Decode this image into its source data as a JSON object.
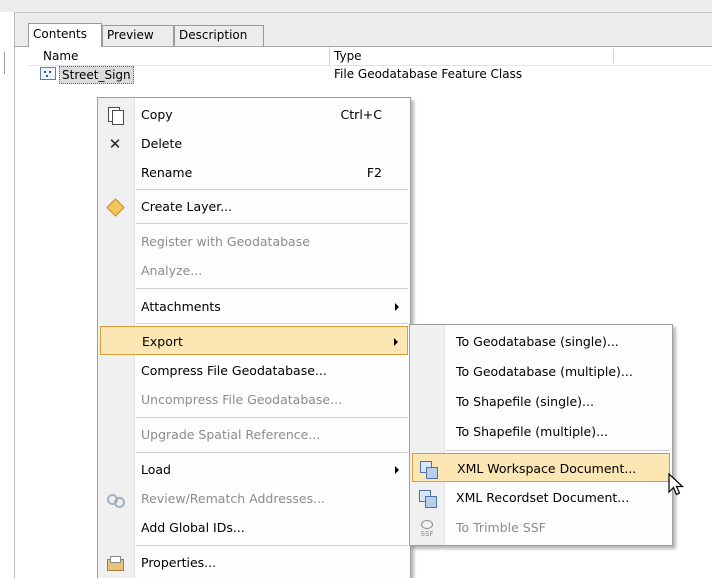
{
  "tabs": [
    {
      "label": "Contents",
      "active": true
    },
    {
      "label": "Preview",
      "active": false
    },
    {
      "label": "Description",
      "active": false
    }
  ],
  "columns": {
    "name": "Name",
    "type": "Type"
  },
  "rows": [
    {
      "name": "Street_Sign",
      "type": "File Geodatabase Feature Class",
      "icon": "point-feature-class-icon"
    }
  ],
  "context_menu": {
    "items": [
      {
        "label": "Copy",
        "shortcut": "Ctrl+C",
        "icon": "copy-icon",
        "enabled": true
      },
      {
        "label": "Delete",
        "shortcut": "",
        "icon": "delete-icon",
        "enabled": true
      },
      {
        "label": "Rename",
        "shortcut": "F2",
        "icon": "",
        "enabled": true
      },
      {
        "label": "Create Layer...",
        "icon": "layer-icon",
        "enabled": true
      },
      {
        "label": "Register with Geodatabase",
        "enabled": false
      },
      {
        "label": "Analyze...",
        "enabled": false
      },
      {
        "label": "Attachments",
        "submenu": true,
        "enabled": true
      },
      {
        "label": "Export",
        "submenu": true,
        "enabled": true,
        "highlighted": true
      },
      {
        "label": "Compress File Geodatabase...",
        "enabled": true
      },
      {
        "label": "Uncompress File Geodatabase...",
        "enabled": false
      },
      {
        "label": "Upgrade Spatial Reference...",
        "enabled": false
      },
      {
        "label": "Load",
        "submenu": true,
        "enabled": true
      },
      {
        "label": "Review/Rematch Addresses...",
        "icon": "review-icon",
        "enabled": false
      },
      {
        "label": "Add Global IDs...",
        "enabled": true
      },
      {
        "label": "Properties...",
        "icon": "properties-icon",
        "enabled": true
      }
    ]
  },
  "export_submenu": {
    "items": [
      {
        "label": "To Geodatabase (single)...",
        "enabled": true
      },
      {
        "label": "To Geodatabase (multiple)...",
        "enabled": true
      },
      {
        "label": "To Shapefile (single)...",
        "enabled": true
      },
      {
        "label": "To Shapefile (multiple)...",
        "enabled": true
      },
      {
        "label": "XML Workspace Document...",
        "icon": "xml-workspace-icon",
        "enabled": true,
        "highlighted": true
      },
      {
        "label": "XML Recordset Document...",
        "icon": "xml-recordset-icon",
        "enabled": true
      },
      {
        "label": "To Trimble SSF",
        "icon": "trimble-ssf-icon",
        "icon_text": "SSF",
        "enabled": false
      }
    ]
  },
  "colors": {
    "highlight_fill": "#fbe6b4",
    "highlight_border": "#d49d3a",
    "disabled_text": "#8c8c8c"
  }
}
